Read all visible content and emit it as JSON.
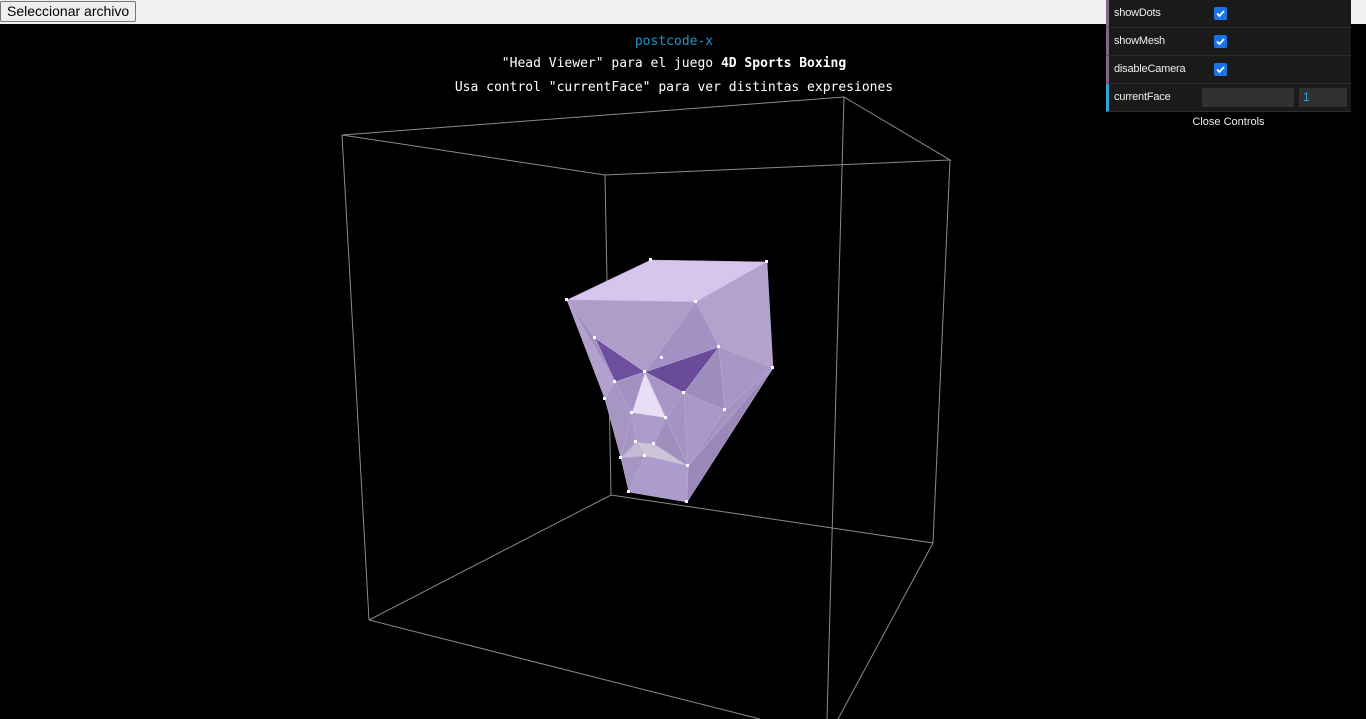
{
  "file_input": {
    "label": "Seleccionar archivo"
  },
  "info": {
    "link": "postcode-x",
    "line1_pre": "\"Head Viewer\" para el juego ",
    "line1_bold": "4D Sports Boxing",
    "line2": "Usa control \"currentFace\" para ver distintas expresiones"
  },
  "gui": {
    "controls": [
      {
        "label": "showDots",
        "checked": true
      },
      {
        "label": "showMesh",
        "checked": true
      },
      {
        "label": "disableCamera",
        "checked": true
      }
    ],
    "current_face": {
      "label": "currentFace",
      "value": "1"
    },
    "close_label": "Close Controls"
  },
  "colors": {
    "background": "#000000",
    "link": "#2194ce",
    "mesh_light": "#d8c6ee",
    "mesh_mid": "#a898c6",
    "mesh_dark": "#6a4b9a",
    "box_lines": "#8a8a8a",
    "checkbox": "#1a73e8"
  }
}
